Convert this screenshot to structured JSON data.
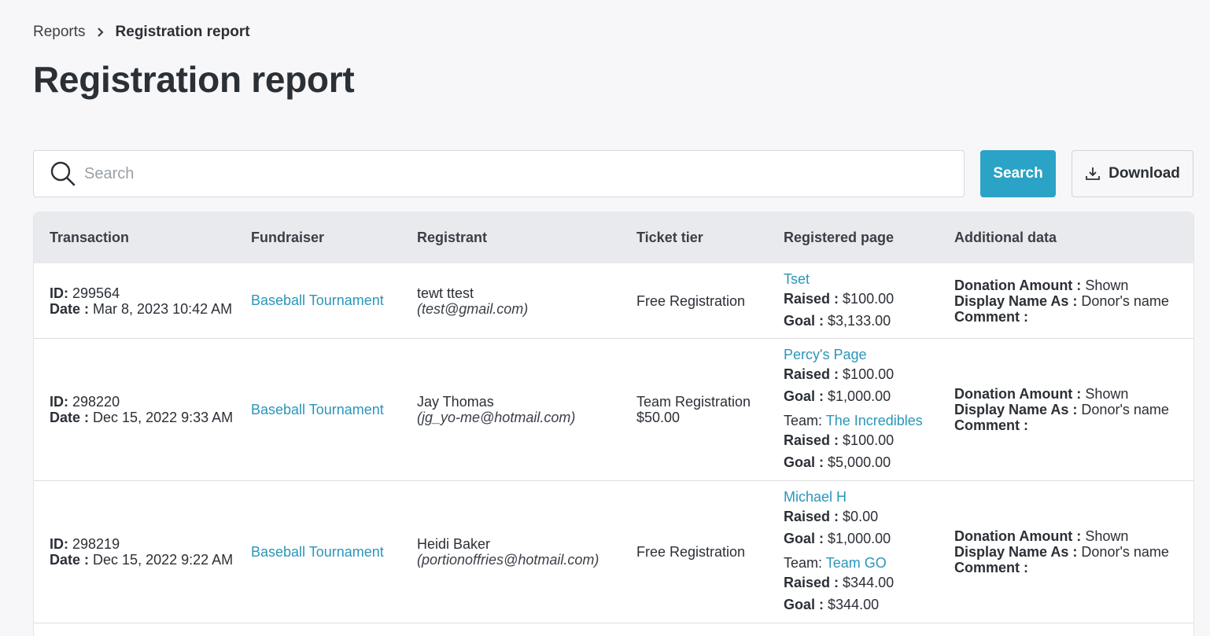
{
  "breadcrumb": {
    "parent": "Reports",
    "current": "Registration report"
  },
  "page_title": "Registration report",
  "search": {
    "placeholder": "Search",
    "value": "",
    "button_label": "Search"
  },
  "download_label": "Download",
  "table": {
    "headers": [
      "Transaction",
      "Fundraiser",
      "Registrant",
      "Ticket tier",
      "Registered page",
      "Additional data"
    ],
    "labels": {
      "id": "ID:",
      "date": "Date :",
      "raised": "Raised :",
      "goal": "Goal :",
      "team": "Team:",
      "donation_amount": "Donation Amount :",
      "display_name_as": "Display Name As :",
      "comment": "Comment :"
    },
    "rows": [
      {
        "id": "299564",
        "date": "Mar 8, 2023 10:42 AM",
        "fundraiser": "Baseball Tournament",
        "registrant_name": "tewt ttest",
        "registrant_email": "(test@gmail.com)",
        "ticket_tier": "Free Registration",
        "ticket_price": "",
        "page_name": "Tset",
        "page_raised": "$100.00",
        "page_goal": "$3,133.00",
        "team_name": "",
        "team_raised": "",
        "team_goal": "",
        "donation_amount": "Shown",
        "display_name_as": "Donor's name",
        "comment": ""
      },
      {
        "id": "298220",
        "date": "Dec 15, 2022 9:33 AM",
        "fundraiser": "Baseball Tournament",
        "registrant_name": "Jay Thomas",
        "registrant_email": "(jg_yo-me@hotmail.com)",
        "ticket_tier": "Team Registration",
        "ticket_price": "$50.00",
        "page_name": "Percy's Page",
        "page_raised": "$100.00",
        "page_goal": "$1,000.00",
        "team_name": "The Incredibles",
        "team_raised": "$100.00",
        "team_goal": "$5,000.00",
        "donation_amount": "Shown",
        "display_name_as": "Donor's name",
        "comment": ""
      },
      {
        "id": "298219",
        "date": "Dec 15, 2022 9:22 AM",
        "fundraiser": "Baseball Tournament",
        "registrant_name": "Heidi Baker",
        "registrant_email": "(portionoffries@hotmail.com)",
        "ticket_tier": "Free Registration",
        "ticket_price": "",
        "page_name": "Michael H",
        "page_raised": "$0.00",
        "page_goal": "$1,000.00",
        "team_name": "Team GO",
        "team_raised": "$344.00",
        "team_goal": "$344.00",
        "donation_amount": "Shown",
        "display_name_as": "Donor's name",
        "comment": ""
      }
    ]
  },
  "icons": {
    "search": "search-icon",
    "download": "download-icon",
    "breadcrumb_sep": "chevron-right-icon"
  },
  "colors": {
    "accent": "#2aa3c6",
    "link": "#2a96b8",
    "header_bg": "#e9eaee",
    "page_bg": "#f7f7f9"
  }
}
